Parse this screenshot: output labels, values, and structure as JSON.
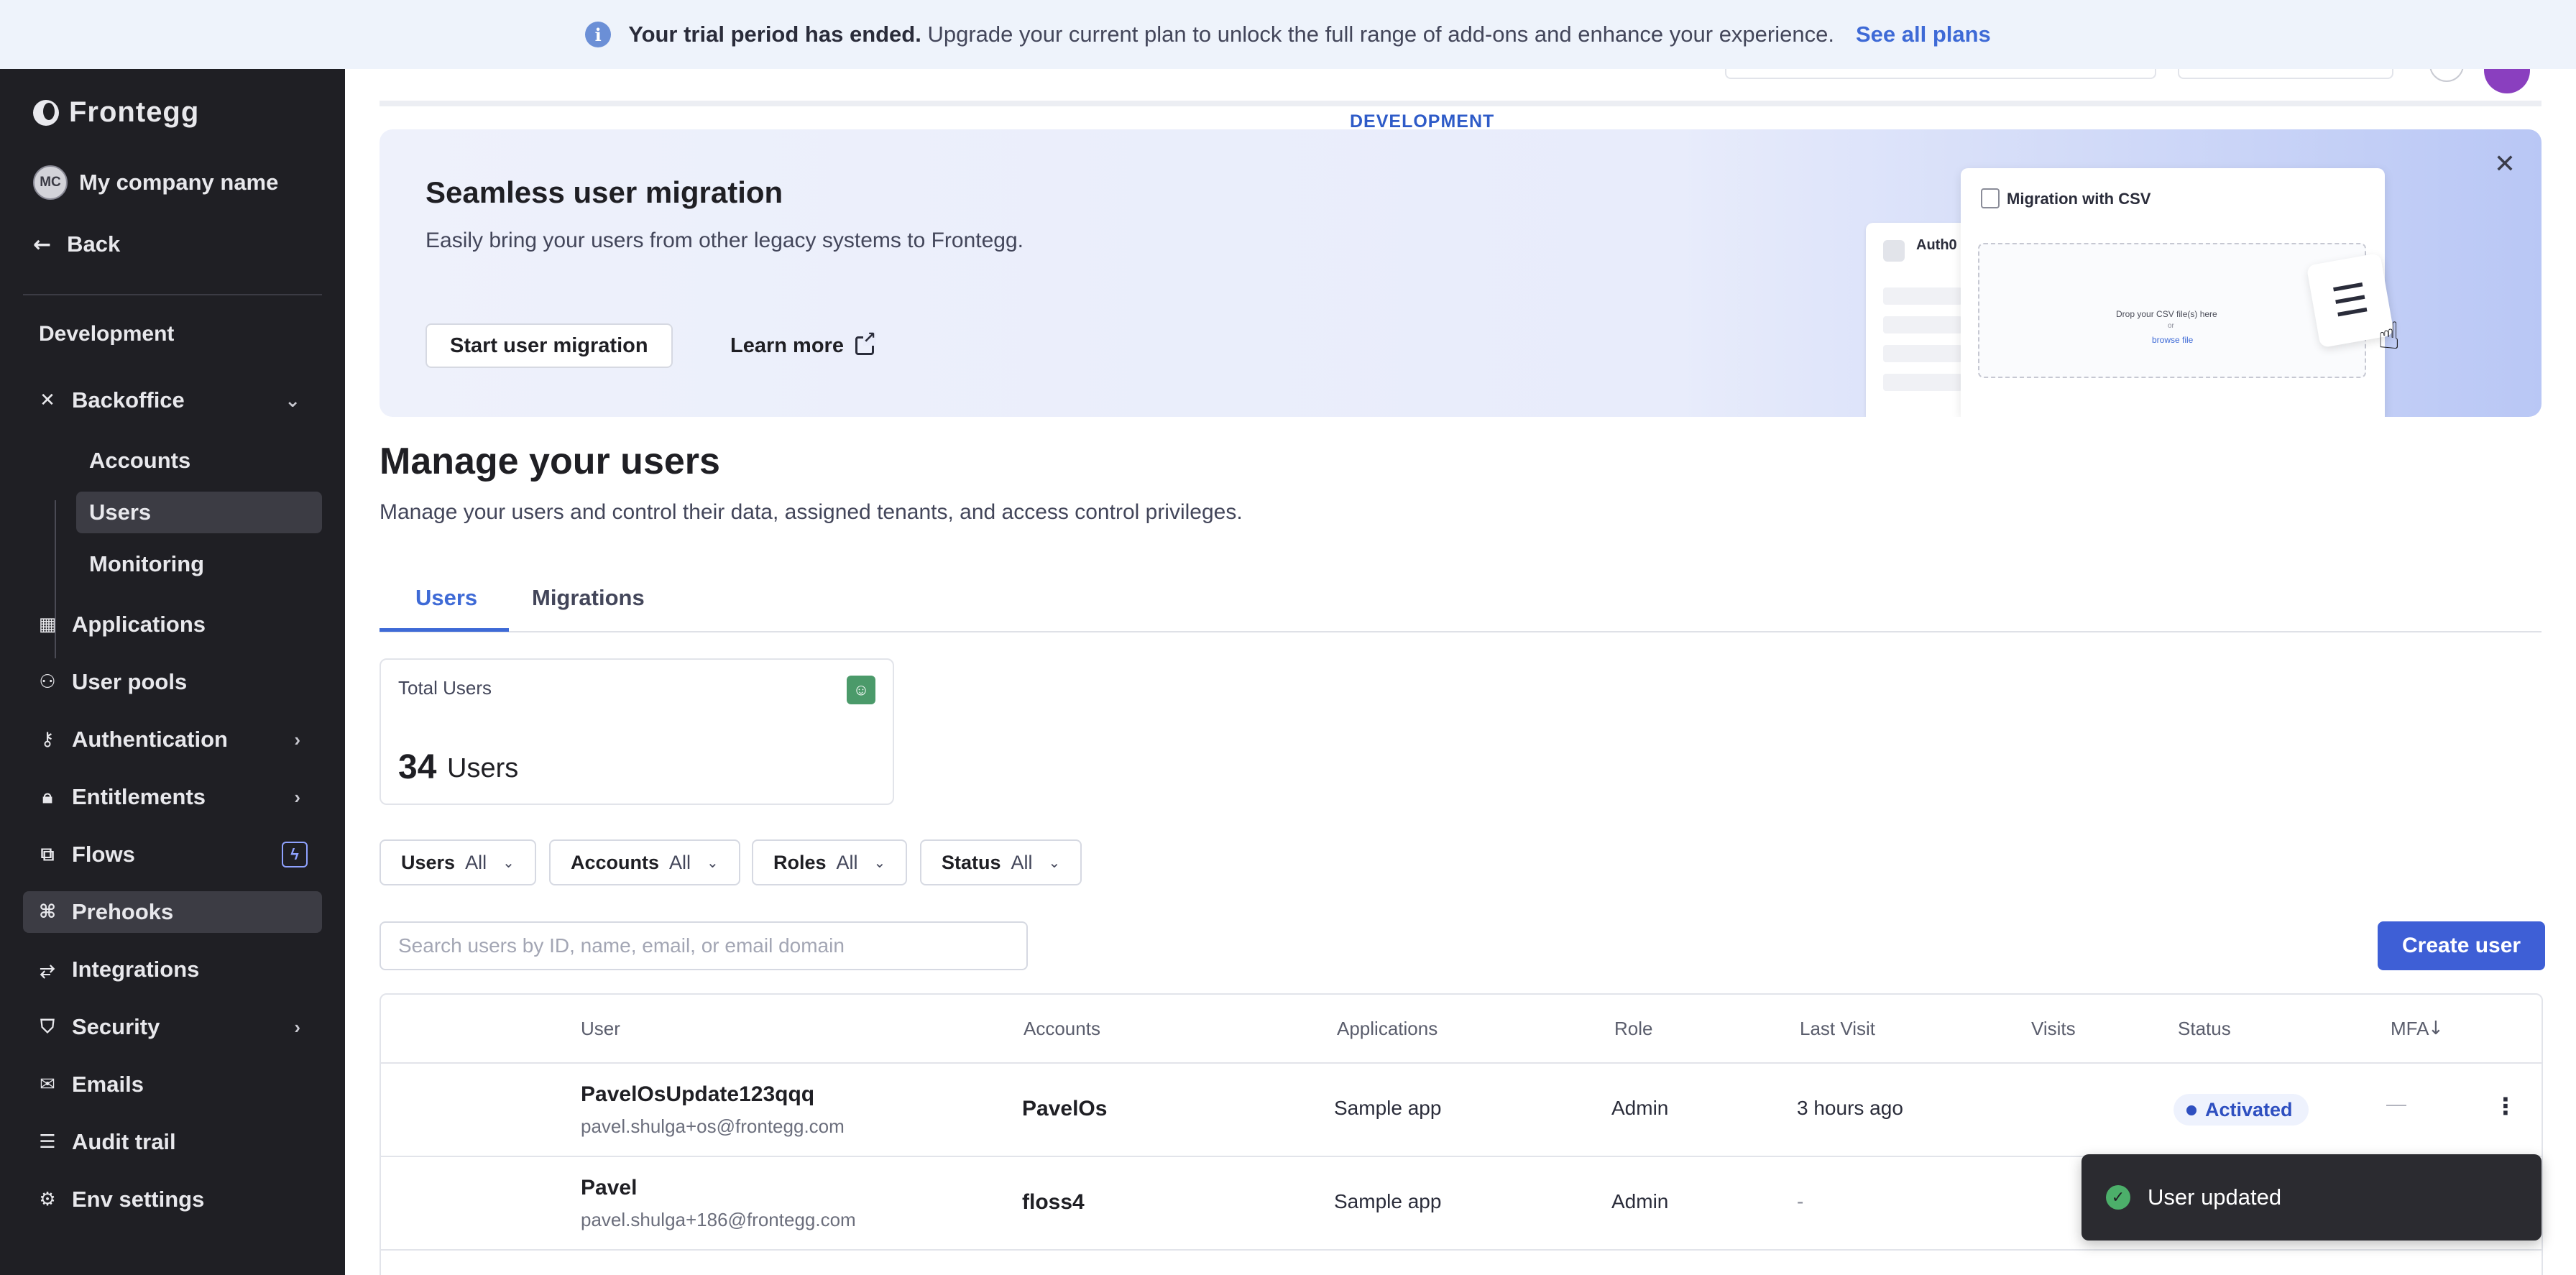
{
  "trial_banner": {
    "icon": "info-icon",
    "bold": "Your trial period has ended.",
    "text": "Upgrade your current plan to unlock the full range of add-ons and enhance your experience.",
    "link": "See all plans"
  },
  "sidebar": {
    "brand": "Frontegg",
    "company_initials": "MC",
    "company_name": "My company name",
    "back": "Back",
    "section": "Development",
    "backoffice": "Backoffice",
    "sub_items": [
      "Accounts",
      "Users",
      "Monitoring"
    ],
    "items": [
      {
        "label": "Applications",
        "icon": "grid-icon"
      },
      {
        "label": "User pools",
        "icon": "users-icon"
      },
      {
        "label": "Authentication",
        "icon": "key-icon"
      },
      {
        "label": "Entitlements",
        "icon": "lock-icon"
      },
      {
        "label": "Flows",
        "icon": "flow-icon"
      },
      {
        "label": "Prehooks",
        "icon": "hook-icon"
      },
      {
        "label": "Integrations",
        "icon": "plug-icon"
      },
      {
        "label": "Security",
        "icon": "shield-icon"
      },
      {
        "label": "Emails",
        "icon": "mail-icon"
      },
      {
        "label": "Audit trail",
        "icon": "list-icon"
      },
      {
        "label": "Env settings",
        "icon": "gear-icon"
      }
    ]
  },
  "env_label": "DEVELOPMENT",
  "promo": {
    "title": "Seamless user migration",
    "description": "Easily bring your users from other legacy systems to Frontegg.",
    "primary_button": "Start user migration",
    "secondary_link": "Learn more",
    "illustration": {
      "auth0_label": "Auth0",
      "csv_title": "Migration with CSV",
      "drop_text": "Drop your CSV file(s) here",
      "drop_or": "or",
      "drop_link": "browse file"
    }
  },
  "page": {
    "title": "Manage your users",
    "description": "Manage your users and control their data, assigned tenants, and access control privileges."
  },
  "tabs": [
    "Users",
    "Migrations"
  ],
  "stats": {
    "label": "Total Users",
    "value": "34",
    "unit": "Users"
  },
  "filters": [
    {
      "name": "Users",
      "value": "All"
    },
    {
      "name": "Accounts",
      "value": "All"
    },
    {
      "name": "Roles",
      "value": "All"
    },
    {
      "name": "Status",
      "value": "All"
    }
  ],
  "search": {
    "placeholder": "Search users by ID, name, email, or email domain",
    "value": ""
  },
  "create_button": "Create user",
  "table": {
    "columns": [
      "User",
      "Accounts",
      "Applications",
      "Role",
      "Last Visit",
      "Visits",
      "Status",
      "MFA"
    ],
    "rows": [
      {
        "name": "PavelOsUpdate123qqq",
        "email": "pavel.shulga+os@frontegg.com",
        "account": "PavelOs",
        "application": "Sample app",
        "role": "Admin",
        "last_visit": "3 hours ago",
        "visits": "",
        "status": "Activated",
        "mfa": "—"
      },
      {
        "name": "Pavel",
        "email": "pavel.shulga+186@frontegg.com",
        "account": "floss4",
        "application": "Sample app",
        "role": "Admin",
        "last_visit": "-",
        "visits": "",
        "status": "",
        "mfa": ""
      }
    ]
  },
  "toast": {
    "message": "User updated"
  }
}
